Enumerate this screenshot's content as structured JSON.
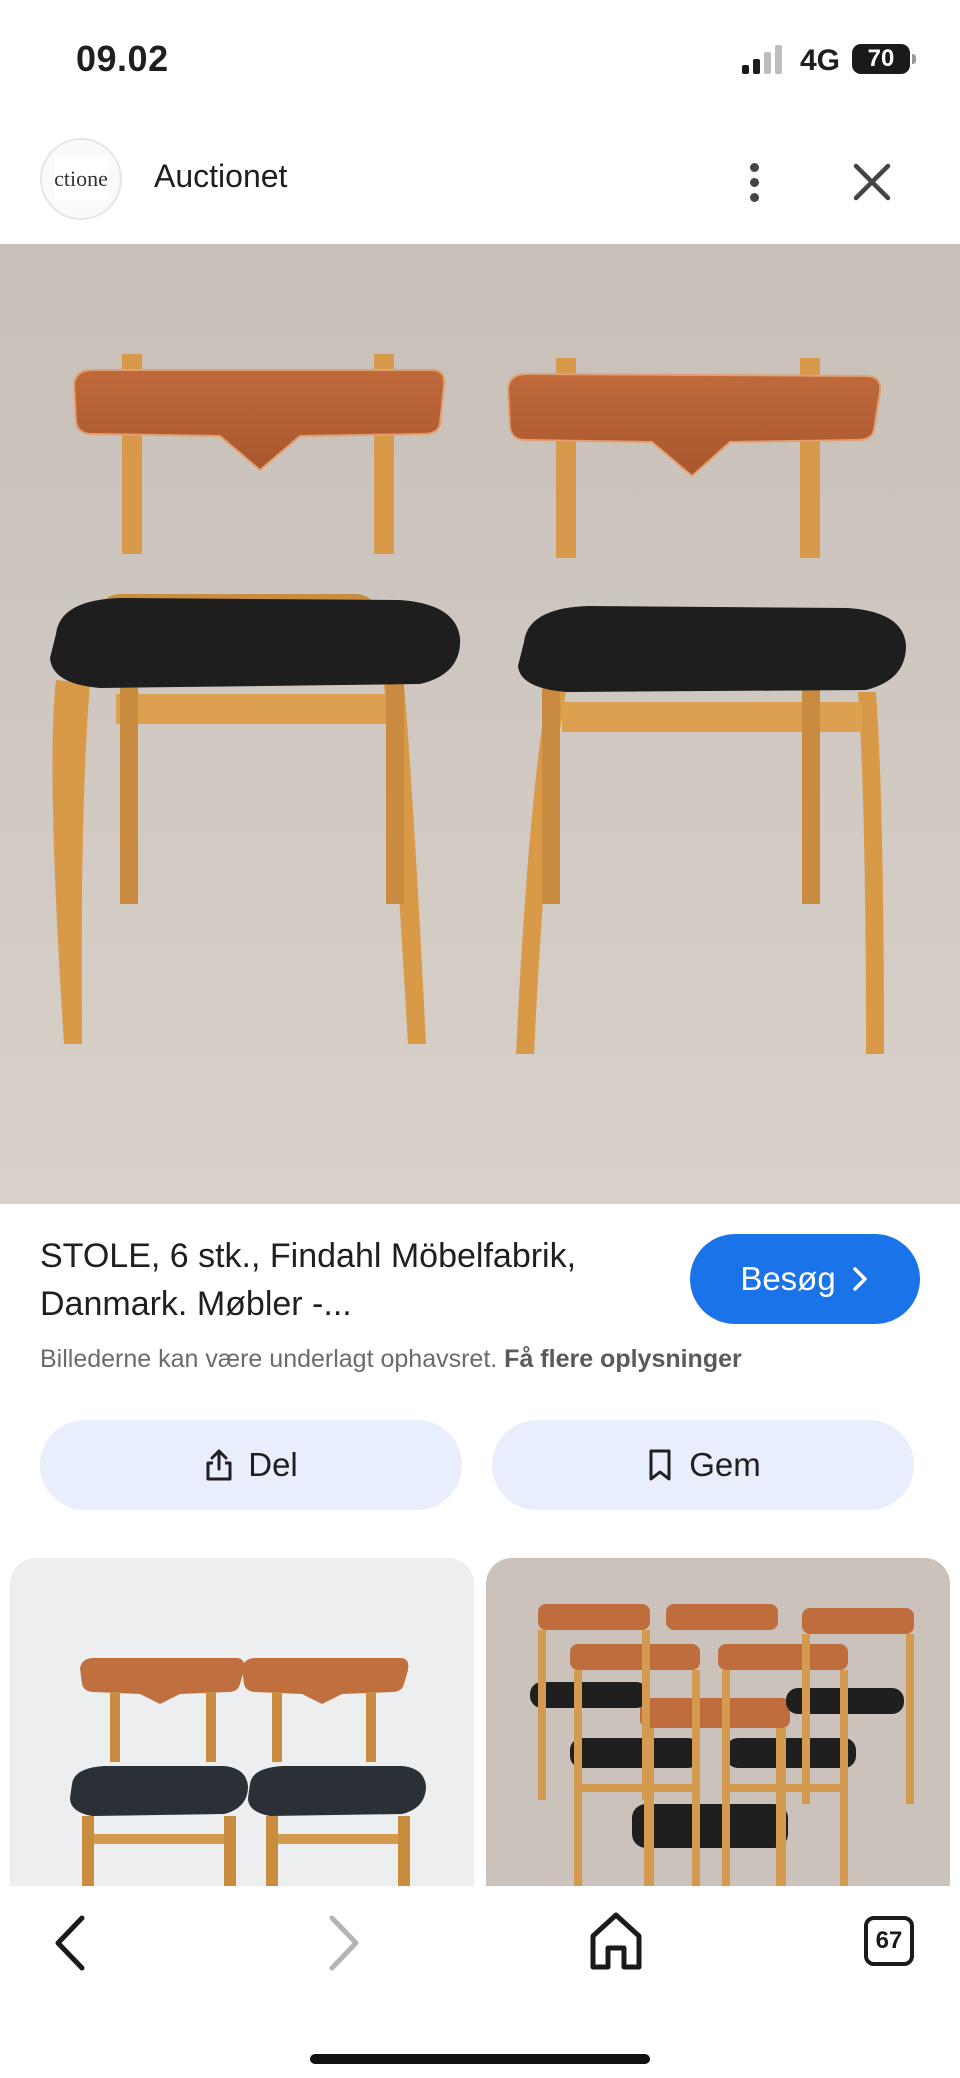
{
  "status_bar": {
    "time": "09.02",
    "network": "4G",
    "battery": "70"
  },
  "header": {
    "logo_text": "ctione",
    "site_name": "Auctionet",
    "more_icon": "more-vert-icon",
    "close_icon": "close-icon"
  },
  "result": {
    "title": "STOLE, 6 stk., Findahl Möbelfabrik, Danmark. Møbler -...",
    "visit_label": "Besøg",
    "copyright_text": "Billederne kan være underlagt ophavsret.",
    "more_info_link": "Få flere oplysninger"
  },
  "actions": {
    "share_label": "Del",
    "save_label": "Gem"
  },
  "bottom_bar": {
    "tab_count": "67"
  },
  "colors": {
    "accent": "#1a73e8",
    "button_bg": "#e8eefb"
  }
}
